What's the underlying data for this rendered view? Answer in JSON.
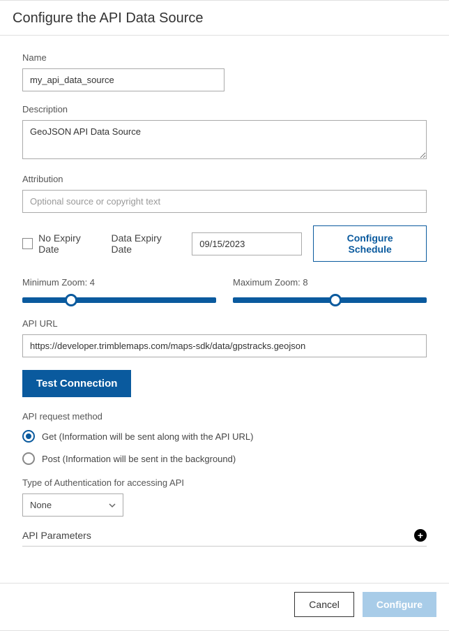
{
  "header": {
    "title": "Configure the API Data Source"
  },
  "fields": {
    "name": {
      "label": "Name",
      "value": "my_api_data_source"
    },
    "description": {
      "label": "Description",
      "value": "GeoJSON API Data Source"
    },
    "attribution": {
      "label": "Attribution",
      "placeholder": "Optional source or copyright text",
      "value": ""
    },
    "noExpiry": {
      "label": "No Expiry Date",
      "checked": false
    },
    "expiryDate": {
      "label": "Data Expiry Date",
      "value": "09/15/2023"
    },
    "minZoom": {
      "label": "Minimum Zoom: 4",
      "value": 4,
      "min": 0,
      "max": 22
    },
    "maxZoom": {
      "label": "Maximum Zoom: 8",
      "value": 8,
      "min": 0,
      "max": 22
    },
    "apiUrl": {
      "label": "API URL",
      "value": "https://developer.trimblemaps.com/maps-sdk/data/gpstracks.geojson"
    },
    "requestMethod": {
      "label": "API request method",
      "options": [
        {
          "label": "Get (Information will be sent along with the API URL)",
          "checked": true
        },
        {
          "label": "Post (Information will be sent in the background)",
          "checked": false
        }
      ]
    },
    "authType": {
      "label": "Type of Authentication for accessing API",
      "value": "None"
    },
    "apiParams": {
      "label": "API Parameters"
    }
  },
  "buttons": {
    "configureSchedule": "Configure Schedule",
    "testConnection": "Test Connection",
    "cancel": "Cancel",
    "configure": "Configure"
  },
  "sliderPositions": {
    "min_percent": 25,
    "max_percent": 53
  }
}
